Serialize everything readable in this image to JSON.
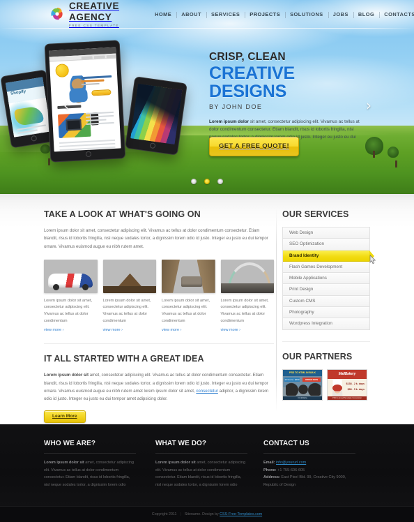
{
  "brand": {
    "title": "CREATIVE AGENCY",
    "subtitle": "FREE CSS TEMPLATE",
    "accent_yellow": "#f2dc14",
    "accent_blue": "#1a73d4"
  },
  "nav": {
    "items": [
      {
        "label": "HOME"
      },
      {
        "label": "ABOUT"
      },
      {
        "label": "SERVICES"
      },
      {
        "label": "PROJECTS"
      },
      {
        "label": "SOLUTIONS"
      },
      {
        "label": "JOBS"
      },
      {
        "label": "BLOG"
      },
      {
        "label": "CONTACTS"
      }
    ]
  },
  "hero": {
    "line1": "CRISP, CLEAN",
    "line2": "CREATIVE DESIGNS",
    "line3": "BY JOHN DOE",
    "paragraph_lead": "Lorem ipsum dolor",
    "paragraph": " sit amet, consectetur adipiscing elit. Vivamus ac tellus at dolor condimentum consectetur. Etiam blandit, risus id lobortis fringilla, nisl neque sodales tortor, a dignissim lorem odio id justo. Integer eu justo eu dui tempor orna euismod amet.",
    "cta_label": "GET A FREE QUOTE!",
    "prev_arrow": "‹",
    "next_arrow": "›",
    "slides": [
      {
        "active": false
      },
      {
        "active": true
      },
      {
        "active": false
      }
    ]
  },
  "news": {
    "title": "TAKE A LOOK AT WHAT'S GOING ON",
    "intro": "Lorem ipsum dolor sit amet, consectetur adipiscing elit. Vivamus ac tellus at dolor condimentum consectetur. Etiam blandit, risus id lobortis fringilla, nisl neque sodales tortor, a dignissim lorem odio id justo. Integer eu justo eu dui tempor ornare. Vivamus euismod augue eu nibh rutem amet.",
    "items": [
      {
        "text": "Lorem ipsum dolor sit amet, consectetur adipiscing elit. Vivamus ac tellus at dolor condimentum",
        "link": "view more ›",
        "image": "race-car-photo"
      },
      {
        "text": "Lorem ipsum dolor sit amet, consectetur adipiscing elit. Vivamus ac tellus at dolor condimentum",
        "link": "view more ›",
        "image": "desert-dune-sunset-photo"
      },
      {
        "text": "Lorem ipsum dolor sit amet, consectetur adipiscing elit. Vivamus ac tellus at dolor condimentum",
        "link": "view more ›",
        "image": "canyon-suv-photo"
      },
      {
        "text": "Lorem ipsum dolor sit amet, consectetur adipiscing elit. Vivamus ac tellus at dolor condimentum",
        "link": "view more ›",
        "image": "desert-road-rainbow-photo"
      }
    ]
  },
  "story": {
    "title": "IT ALL STARTED WITH A GREAT IDEA",
    "lead": "Lorem ipsum dolor sit",
    "body_a": " amet, consectetur adipiscing elit. Vivamus ac tellus at dolor condimentum consectetur. Etiam blandit, risus id lobortis fringilla, nisl neque sodales tortor, a dignissim lorem odio id justo. Integer eu justo eu dui tempor ornare. Vivamus euismod augue eu nibh rutem amet lorem ipsum dolor sit amet, ",
    "link": "consectetur",
    "body_b": " adipitor, a dignissim lorem odio id justo. Integer eu justo eu dui tempor amet adipsicing dolor.",
    "cta_label": "Learn More"
  },
  "services": {
    "title": "OUR SERVICES",
    "items": [
      {
        "label": "Web Design",
        "active": false
      },
      {
        "label": "SEO Optimization",
        "active": false
      },
      {
        "label": "Brand Identity",
        "active": true
      },
      {
        "label": "Flash Games Development",
        "active": false
      },
      {
        "label": "Mobile Applications",
        "active": false
      },
      {
        "label": "Print Design",
        "active": false
      },
      {
        "label": "Custom CMS",
        "active": false
      },
      {
        "label": "Photography",
        "active": false
      },
      {
        "label": "Wordpress Integration",
        "active": false
      }
    ]
  },
  "partners": {
    "title": "OUR PARTNERS",
    "banner1": {
      "headline": "PSD TO HTML IN BULK",
      "price": "12 hours • $400",
      "cta": "ORDER NOW",
      "footer": "htmlMafia"
    },
    "banner2": {
      "headline": "MailBakery",
      "price1": "$138 - 2 k. days",
      "price2": "$98 - 5 k. days",
      "footer": "PSD to Email Template Conversion"
    }
  },
  "footer": {
    "columns": [
      {
        "title": "WHO WE ARE?",
        "lead": "Lorem ipsum dolor sit",
        "body": " amet, consectetur adipiscing elit. Vivamus ac tellus at dolor condimentum consectetur. Etiam blandit, risus id lobortis fringilla, nisl neque sodales tortor, a dignissim lorem odio"
      },
      {
        "title": "WHAT WE DO?",
        "lead": "Lorem ipsum dolor sit",
        "body": " amet, consectetur adipiscing elit. Vivamus ac tellus at dolor condimentum consectetur. Etiam blandit, risus id lobortis fringilla, nisl neque sodales tortor, a dignissim lorem odio"
      }
    ],
    "contact": {
      "title": "CONTACT US",
      "email_label": "Email:",
      "email_value": "info@yoururl.com",
      "phone_label": "Phone:",
      "phone_value": "+1 755-606-605",
      "address_label": "Address:",
      "address_value": "East Pixel Bld. 99, Creative City 9000, Republic of Design"
    }
  },
  "copyright": {
    "text": "Copyright 2011",
    "divider": "|",
    "sitename": "Sitename. Design by ",
    "link": "CSS-Free-Templates.com"
  }
}
